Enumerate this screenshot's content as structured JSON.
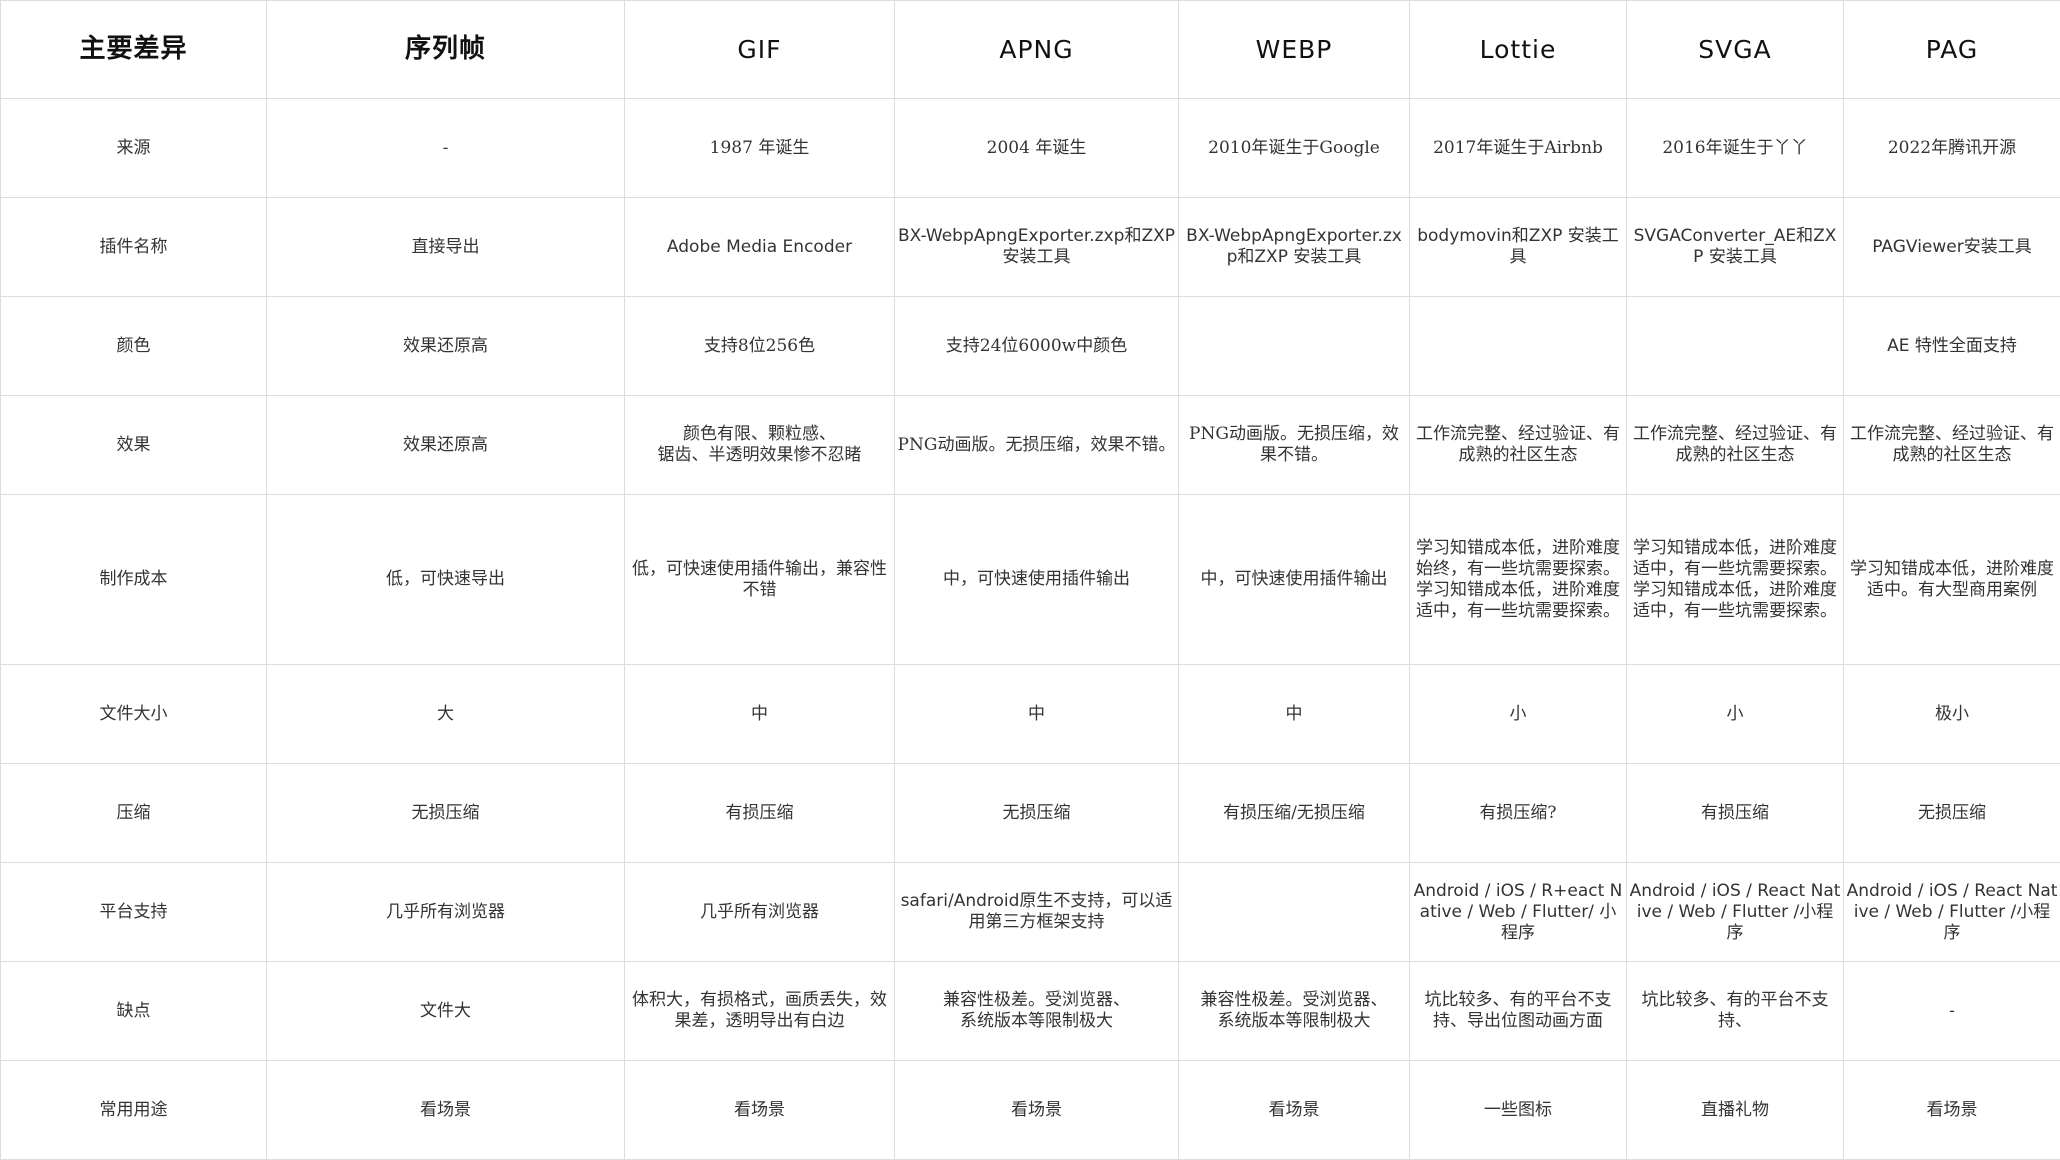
{
  "table": {
    "headers": [
      "主要差异",
      "序列帧",
      "GIF",
      "APNG",
      "WEBP",
      "Lottie",
      "SVGA",
      "PAG"
    ],
    "rows": [
      {
        "label": "来源",
        "cells": [
          "-",
          "1987 年诞生",
          "2004 年诞生",
          "2010年诞生于Google",
          "2017年诞生于Airbnb",
          "2016年诞生于丫丫",
          "2022年腾讯开源"
        ]
      },
      {
        "label": "插件名称",
        "cells": [
          "直接导出",
          "Adobe Media Encoder",
          "BX-WebpApngExporter.zxp和ZXP 安装工具",
          "BX-WebpApngExporter.zxp和ZXP 安装工具",
          "bodymovin和ZXP 安装工具",
          "SVGAConverter_AE和ZXP 安装工具",
          "PAGViewer安装工具"
        ]
      },
      {
        "label": "颜色",
        "cells": [
          "效果还原高",
          "支持8位256色",
          "支持24位6000w中颜色",
          "",
          "",
          "",
          "AE 特性全面支持"
        ]
      },
      {
        "label": "效果",
        "cells": [
          "效果还原高",
          "颜色有限、颗粒感、\n锯齿、半透明效果惨不忍睹",
          "PNG动画版。无损压缩，效果不错。",
          "PNG动画版。无损压缩，效果不错。",
          "工作流完整、经过验证、有成熟的社区生态",
          "工作流完整、经过验证、有成熟的社区生态",
          "工作流完整、经过验证、有成熟的社区生态"
        ]
      },
      {
        "label": "制作成本",
        "cells": [
          "低，可快速导出",
          "低，可快速使用插件输出，兼容性不错",
          "中，可快速使用插件输出",
          "中，可快速使用插件输出",
          "学习知错成本低，进阶难度始终，有一些坑需要探索。学习知错成本低，进阶难度适中，有一些坑需要探索。",
          "学习知错成本低，进阶难度适中，有一些坑需要探索。学习知错成本低，进阶难度适中，有一些坑需要探索。",
          "学习知错成本低，进阶难度适中。有大型商用案例"
        ]
      },
      {
        "label": "文件大小",
        "cells": [
          "大",
          "中",
          "中",
          "中",
          "小",
          "小",
          "极小"
        ]
      },
      {
        "label": "压缩",
        "cells": [
          "无损压缩",
          "有损压缩",
          "无损压缩",
          "有损压缩/无损压缩",
          "有损压缩?",
          "有损压缩",
          "无损压缩"
        ]
      },
      {
        "label": "平台支持",
        "cells": [
          "几乎所有浏览器",
          "几乎所有浏览器",
          "safari/Android原生不支持，可以适用第三方框架支持",
          "",
          "Android / iOS / R+eact Native / Web / Flutter/ 小程序",
          "Android / iOS / React Native / Web / Flutter /小程序",
          "Android / iOS / React Native / Web / Flutter /小程序"
        ]
      },
      {
        "label": "缺点",
        "cells": [
          "文件大",
          "体积大，有损格式，画质丢失，效果差，透明导出有白边",
          "兼容性极差。受浏览器、\n系统版本等限制极大",
          "兼容性极差。受浏览器、\n系统版本等限制极大",
          "坑比较多、有的平台不支持、导出位图动画方面",
          "坑比较多、有的平台不支持、",
          "-"
        ]
      },
      {
        "label": "常用用途",
        "cells": [
          "看场景",
          "看场景",
          "看场景",
          "看场景",
          "一些图标",
          "直播礼物",
          "看场景"
        ]
      }
    ]
  }
}
